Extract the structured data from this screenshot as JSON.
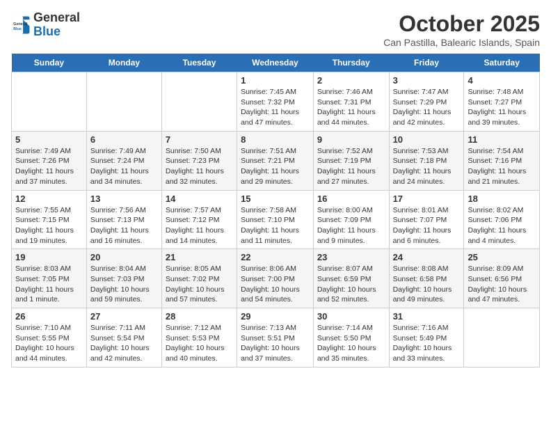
{
  "header": {
    "logo_general": "General",
    "logo_blue": "Blue",
    "title": "October 2025",
    "subtitle": "Can Pastilla, Balearic Islands, Spain"
  },
  "weekdays": [
    "Sunday",
    "Monday",
    "Tuesday",
    "Wednesday",
    "Thursday",
    "Friday",
    "Saturday"
  ],
  "weeks": [
    [
      {
        "day": "",
        "info": ""
      },
      {
        "day": "",
        "info": ""
      },
      {
        "day": "",
        "info": ""
      },
      {
        "day": "1",
        "info": "Sunrise: 7:45 AM\nSunset: 7:32 PM\nDaylight: 11 hours and 47 minutes."
      },
      {
        "day": "2",
        "info": "Sunrise: 7:46 AM\nSunset: 7:31 PM\nDaylight: 11 hours and 44 minutes."
      },
      {
        "day": "3",
        "info": "Sunrise: 7:47 AM\nSunset: 7:29 PM\nDaylight: 11 hours and 42 minutes."
      },
      {
        "day": "4",
        "info": "Sunrise: 7:48 AM\nSunset: 7:27 PM\nDaylight: 11 hours and 39 minutes."
      }
    ],
    [
      {
        "day": "5",
        "info": "Sunrise: 7:49 AM\nSunset: 7:26 PM\nDaylight: 11 hours and 37 minutes."
      },
      {
        "day": "6",
        "info": "Sunrise: 7:49 AM\nSunset: 7:24 PM\nDaylight: 11 hours and 34 minutes."
      },
      {
        "day": "7",
        "info": "Sunrise: 7:50 AM\nSunset: 7:23 PM\nDaylight: 11 hours and 32 minutes."
      },
      {
        "day": "8",
        "info": "Sunrise: 7:51 AM\nSunset: 7:21 PM\nDaylight: 11 hours and 29 minutes."
      },
      {
        "day": "9",
        "info": "Sunrise: 7:52 AM\nSunset: 7:19 PM\nDaylight: 11 hours and 27 minutes."
      },
      {
        "day": "10",
        "info": "Sunrise: 7:53 AM\nSunset: 7:18 PM\nDaylight: 11 hours and 24 minutes."
      },
      {
        "day": "11",
        "info": "Sunrise: 7:54 AM\nSunset: 7:16 PM\nDaylight: 11 hours and 21 minutes."
      }
    ],
    [
      {
        "day": "12",
        "info": "Sunrise: 7:55 AM\nSunset: 7:15 PM\nDaylight: 11 hours and 19 minutes."
      },
      {
        "day": "13",
        "info": "Sunrise: 7:56 AM\nSunset: 7:13 PM\nDaylight: 11 hours and 16 minutes."
      },
      {
        "day": "14",
        "info": "Sunrise: 7:57 AM\nSunset: 7:12 PM\nDaylight: 11 hours and 14 minutes."
      },
      {
        "day": "15",
        "info": "Sunrise: 7:58 AM\nSunset: 7:10 PM\nDaylight: 11 hours and 11 minutes."
      },
      {
        "day": "16",
        "info": "Sunrise: 8:00 AM\nSunset: 7:09 PM\nDaylight: 11 hours and 9 minutes."
      },
      {
        "day": "17",
        "info": "Sunrise: 8:01 AM\nSunset: 7:07 PM\nDaylight: 11 hours and 6 minutes."
      },
      {
        "day": "18",
        "info": "Sunrise: 8:02 AM\nSunset: 7:06 PM\nDaylight: 11 hours and 4 minutes."
      }
    ],
    [
      {
        "day": "19",
        "info": "Sunrise: 8:03 AM\nSunset: 7:05 PM\nDaylight: 11 hours and 1 minute."
      },
      {
        "day": "20",
        "info": "Sunrise: 8:04 AM\nSunset: 7:03 PM\nDaylight: 10 hours and 59 minutes."
      },
      {
        "day": "21",
        "info": "Sunrise: 8:05 AM\nSunset: 7:02 PM\nDaylight: 10 hours and 57 minutes."
      },
      {
        "day": "22",
        "info": "Sunrise: 8:06 AM\nSunset: 7:00 PM\nDaylight: 10 hours and 54 minutes."
      },
      {
        "day": "23",
        "info": "Sunrise: 8:07 AM\nSunset: 6:59 PM\nDaylight: 10 hours and 52 minutes."
      },
      {
        "day": "24",
        "info": "Sunrise: 8:08 AM\nSunset: 6:58 PM\nDaylight: 10 hours and 49 minutes."
      },
      {
        "day": "25",
        "info": "Sunrise: 8:09 AM\nSunset: 6:56 PM\nDaylight: 10 hours and 47 minutes."
      }
    ],
    [
      {
        "day": "26",
        "info": "Sunrise: 7:10 AM\nSunset: 5:55 PM\nDaylight: 10 hours and 44 minutes."
      },
      {
        "day": "27",
        "info": "Sunrise: 7:11 AM\nSunset: 5:54 PM\nDaylight: 10 hours and 42 minutes."
      },
      {
        "day": "28",
        "info": "Sunrise: 7:12 AM\nSunset: 5:53 PM\nDaylight: 10 hours and 40 minutes."
      },
      {
        "day": "29",
        "info": "Sunrise: 7:13 AM\nSunset: 5:51 PM\nDaylight: 10 hours and 37 minutes."
      },
      {
        "day": "30",
        "info": "Sunrise: 7:14 AM\nSunset: 5:50 PM\nDaylight: 10 hours and 35 minutes."
      },
      {
        "day": "31",
        "info": "Sunrise: 7:16 AM\nSunset: 5:49 PM\nDaylight: 10 hours and 33 minutes."
      },
      {
        "day": "",
        "info": ""
      }
    ]
  ]
}
